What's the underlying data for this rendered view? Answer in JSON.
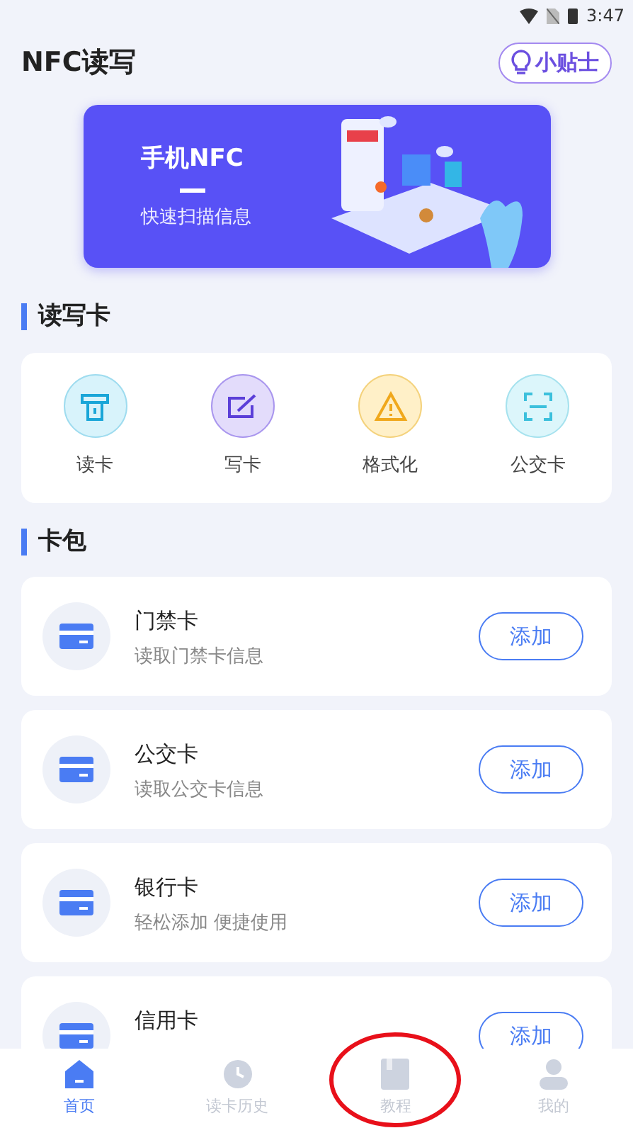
{
  "status_bar": {
    "time": "3:47"
  },
  "header": {
    "title": "NFC读写",
    "tips_button": "小贴士"
  },
  "banner": {
    "title": "手机NFC",
    "subtitle": "快速扫描信息"
  },
  "read_write_section": {
    "title": "读写卡",
    "actions": [
      {
        "label": "读卡",
        "kind": "read"
      },
      {
        "label": "写卡",
        "kind": "write"
      },
      {
        "label": "格式化",
        "kind": "format"
      },
      {
        "label": "公交卡",
        "kind": "scan"
      }
    ]
  },
  "wallet_section": {
    "title": "卡包",
    "cards": [
      {
        "name": "门禁卡",
        "description": "读取门禁卡信息",
        "button": "添加"
      },
      {
        "name": "公交卡",
        "description": "读取公交卡信息",
        "button": "添加"
      },
      {
        "name": "银行卡",
        "description": "轻松添加 便捷使用",
        "button": "添加"
      },
      {
        "name": "信用卡",
        "button": "添加"
      }
    ]
  },
  "bottom_nav": [
    {
      "label": "首页",
      "kind": "home",
      "selected": true,
      "circled": false
    },
    {
      "label": "读卡历史",
      "kind": "history",
      "selected": false,
      "circled": false
    },
    {
      "label": "教程",
      "kind": "book",
      "selected": false,
      "circled": true
    },
    {
      "label": "我的",
      "kind": "person",
      "selected": false,
      "circled": false
    }
  ]
}
